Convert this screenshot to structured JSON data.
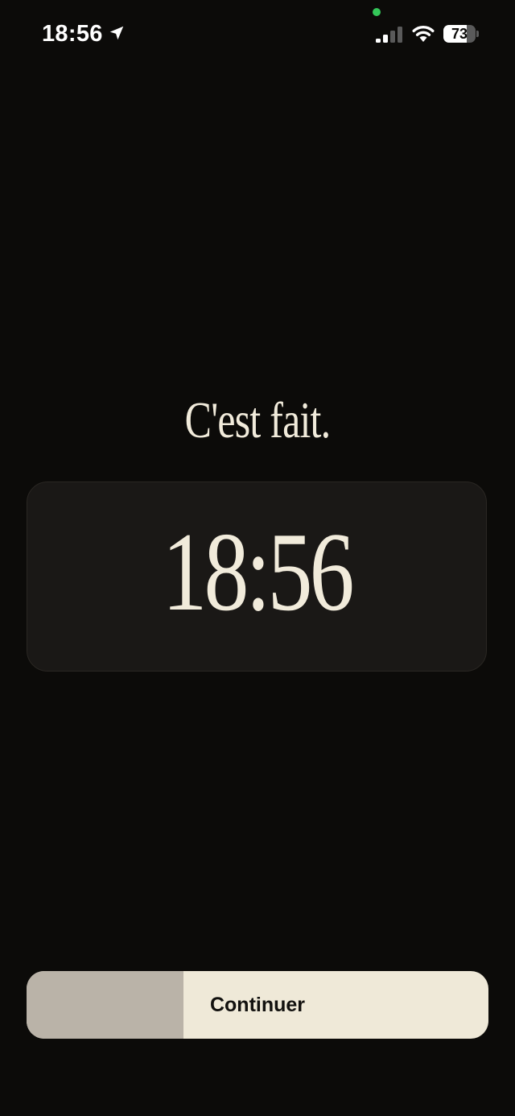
{
  "status_bar": {
    "time": "18:56",
    "location_icon": "location-arrow-icon",
    "privacy_indicator_color": "#34c759",
    "signal_icon": "cellular-signal-icon",
    "signal_bars_active": 2,
    "signal_bars_total": 4,
    "wifi_icon": "wifi-icon",
    "battery_level": "73",
    "battery_fraction": 0.73
  },
  "main": {
    "headline": "C'est fait.",
    "time_display": "18:56"
  },
  "continue_button": {
    "label": "Continuer",
    "progress_fraction": 0.34
  },
  "colors": {
    "background": "#0c0b09",
    "card": "#1a1816",
    "cream": "#efe9d8",
    "progress": "#bab3a8"
  }
}
